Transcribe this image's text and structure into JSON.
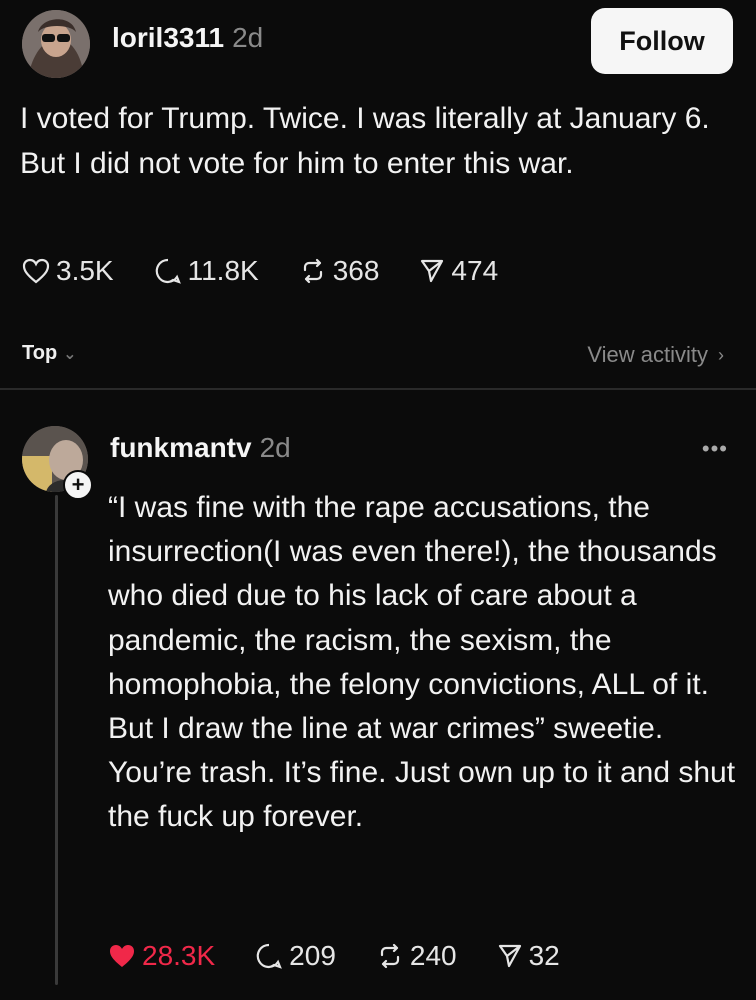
{
  "post": {
    "username": "loril3311",
    "time": "2d",
    "follow_label": "Follow",
    "text": "I voted for Trump. Twice. I was literally at January 6. But I did not vote for him to enter this war.",
    "stats": {
      "likes": "3.5K",
      "replies": "11.8K",
      "reposts": "368",
      "shares": "474"
    }
  },
  "sort": {
    "label": "Top",
    "view_activity": "View activity"
  },
  "reply": {
    "username": "funkmantv",
    "time": "2d",
    "more": "•••",
    "plus": "+",
    "text": "“I was fine with the rape accusations, the insurrection(I was even there!), the thousands who died due to his lack of care about a pandemic, the racism, the sexism, the homophobia, the felony convictions, ALL of it. But I draw the line at war crimes” sweetie. You’re trash. It’s fine. Just own up to it and shut the fuck up forever.",
    "stats": {
      "likes": "28.3K",
      "replies": "209",
      "reposts": "240",
      "shares": "32"
    }
  },
  "colors": {
    "background": "#0b0b0b",
    "liked": "#f02849",
    "muted": "#8a8a8a"
  },
  "icons": [
    "heart-icon",
    "comment-icon",
    "repost-icon",
    "share-icon",
    "chevron-down-icon",
    "chevron-right-icon",
    "more-icon"
  ]
}
